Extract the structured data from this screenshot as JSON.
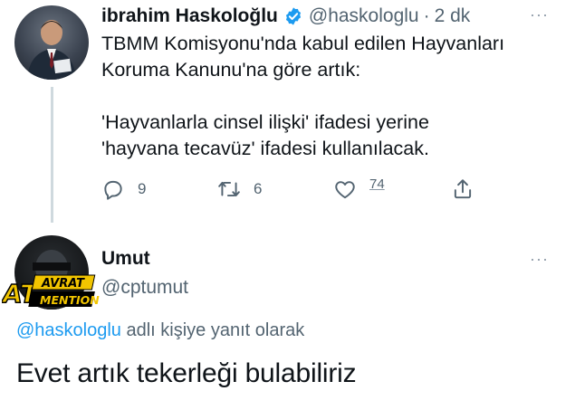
{
  "tweet1": {
    "name": "ibrahim Haskoloğlu",
    "handle": "@haskologlu",
    "separator": "·",
    "time": "2 dk",
    "more": "···",
    "text_line1": "TBMM Komisyonu'nda kabul edilen Hayvanları",
    "text_line2": "Koruma Kanunu'na göre artık:",
    "text_line3": "'Hayvanlarla cinsel ilişki' ifadesi yerine",
    "text_line4": "'hayvana tecavüz' ifadesi kullanılacak.",
    "actions": {
      "reply_count": "9",
      "retweet_count": "6",
      "like_count": "74"
    },
    "icons": {
      "verified": "verified-badge-icon",
      "reply": "reply-icon",
      "retweet": "retweet-icon",
      "like": "heart-icon",
      "share": "share-icon"
    },
    "verified_color": "#1d9bf0"
  },
  "tweet2": {
    "name": "Umut",
    "handle": "@cptumut",
    "more": "···",
    "watermark_line1": "AVRAT",
    "watermark_line2": "MENTION",
    "watermark_prefix": "AT",
    "reply_prefix": "@haskologlu",
    "reply_suffix": " adlı kişiye yanıt olarak",
    "text": "Evet artık tekerleği bulabiliriz"
  },
  "colors": {
    "text_primary": "#0f1419",
    "text_secondary": "#536471",
    "accent": "#1d9bf0",
    "thread_line": "#cfd9de"
  }
}
